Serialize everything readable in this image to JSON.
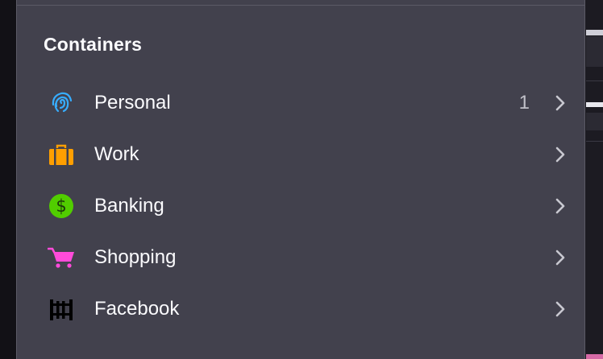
{
  "containers_panel": {
    "heading": "Containers",
    "items": [
      {
        "label": "Personal",
        "count": "1",
        "icon": "fingerprint-icon",
        "color": "#37adff"
      },
      {
        "label": "Work",
        "count": "",
        "icon": "briefcase-icon",
        "color": "#ff9f00"
      },
      {
        "label": "Banking",
        "count": "",
        "icon": "dollar-icon",
        "color": "#51cd00"
      },
      {
        "label": "Shopping",
        "count": "",
        "icon": "cart-icon",
        "color": "#ff4bda"
      },
      {
        "label": "Facebook",
        "count": "",
        "icon": "fence-icon",
        "color": "#000000"
      }
    ]
  }
}
